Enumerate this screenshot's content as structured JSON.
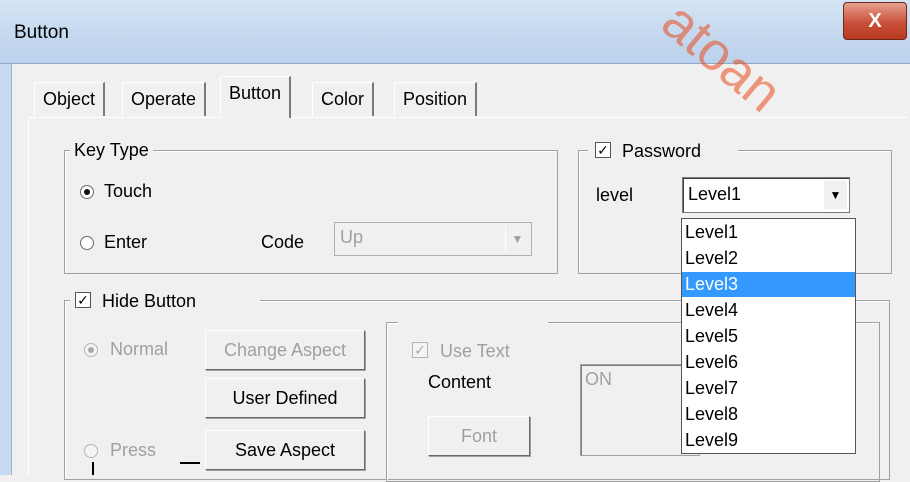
{
  "window": {
    "title": "Button",
    "close_glyph": "X"
  },
  "watermark": {
    "text": "atoan"
  },
  "tabs": [
    {
      "label": "Object"
    },
    {
      "label": "Operate"
    },
    {
      "label": "Button"
    },
    {
      "label": "Color"
    },
    {
      "label": "Position"
    }
  ],
  "active_tab": "Button",
  "key_type": {
    "legend": "Key Type",
    "touch_label": "Touch",
    "enter_label": "Enter",
    "selected": "Touch",
    "code_label": "Code",
    "code_value": "Up"
  },
  "password": {
    "label": "Password",
    "checked": true,
    "level_label": "level",
    "level_value": "Level1",
    "options": [
      "Level1",
      "Level2",
      "Level3",
      "Level4",
      "Level5",
      "Level6",
      "Level7",
      "Level8",
      "Level9"
    ],
    "highlighted": "Level3"
  },
  "hide_button": {
    "label": "Hide Button",
    "checked": true,
    "normal_label": "Normal",
    "press_label": "Press",
    "change_aspect": "Change Aspect",
    "user_defined": "User Defined",
    "save_aspect": "Save Aspect",
    "use_text_label": "Use Text",
    "content_label": "Content",
    "content_value": "ON",
    "font_button": "Font"
  },
  "colors": {
    "title_text": "#000000",
    "selection": "#3399ff",
    "close_button": "#c9503a"
  },
  "icons": {
    "close": "close-icon",
    "dropdown": "chevron-down-icon",
    "check": "check-icon"
  }
}
